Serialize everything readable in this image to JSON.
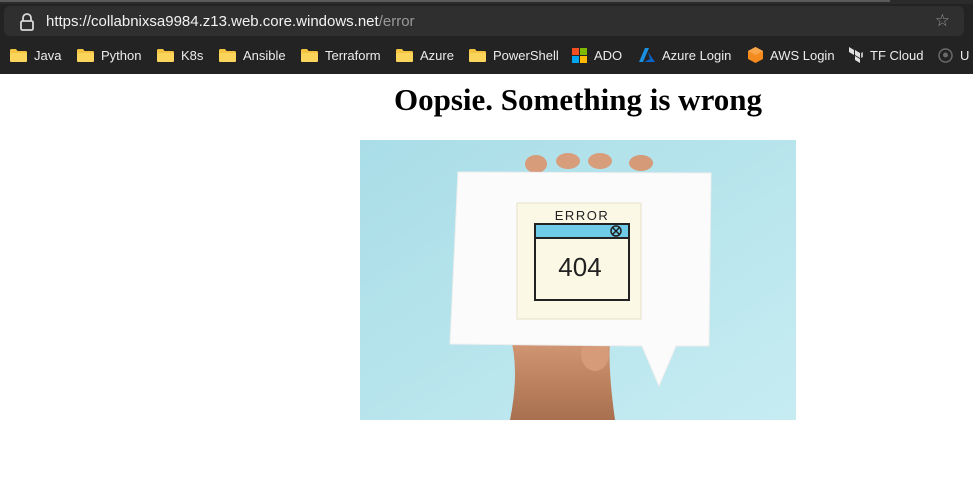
{
  "browser": {
    "url_host": "https://collabnixsa9984.z13.web.core.windows.net",
    "url_path": "/error",
    "bookmarks": [
      {
        "label": "Java",
        "icon": "folder-icon"
      },
      {
        "label": "Python",
        "icon": "folder-icon"
      },
      {
        "label": "K8s",
        "icon": "folder-icon"
      },
      {
        "label": "Ansible",
        "icon": "folder-icon"
      },
      {
        "label": "Terraform",
        "icon": "folder-icon"
      },
      {
        "label": "Azure",
        "icon": "folder-icon"
      },
      {
        "label": "PowerShell",
        "icon": "folder-icon"
      },
      {
        "label": "ADO",
        "icon": "microsoft-logo-icon"
      },
      {
        "label": "Azure Login",
        "icon": "azure-logo-icon"
      },
      {
        "label": "AWS Login",
        "icon": "aws-logo-icon"
      },
      {
        "label": "TF Cloud",
        "icon": "terraform-logo-icon"
      },
      {
        "label": "U",
        "icon": "github-logo-icon"
      }
    ]
  },
  "page": {
    "heading": "Oopsie. Something is wrong",
    "image": {
      "note_title": "ERROR",
      "note_code": "404"
    }
  },
  "colors": {
    "browser_chrome": "#232324",
    "folder": "#f5c542",
    "image_background": "#b5e3ec",
    "window_bar": "#6fcbe8"
  }
}
